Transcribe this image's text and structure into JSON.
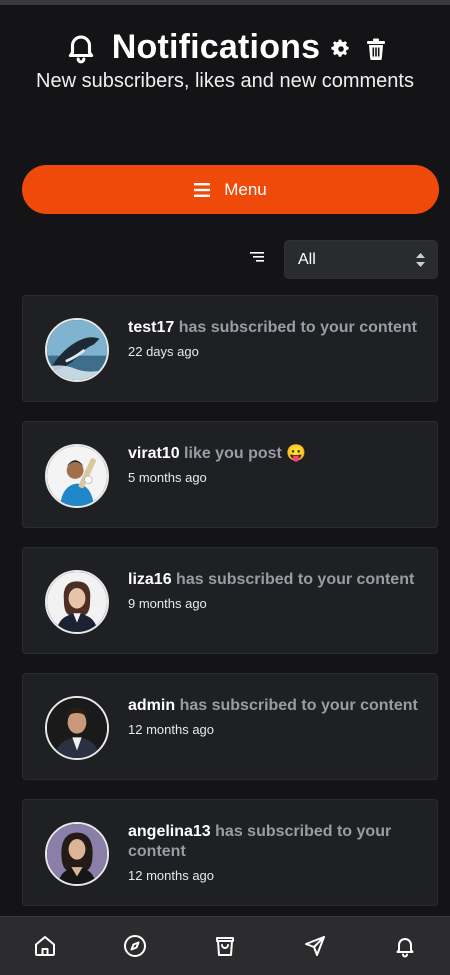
{
  "header": {
    "title": "Notifications",
    "subtitle": "New subscribers, likes and new comments",
    "icons": [
      "bell-icon",
      "gear-icon",
      "trash-icon"
    ]
  },
  "menu": {
    "label": "Menu",
    "color": "#f04a0a"
  },
  "filter": {
    "selected": "All"
  },
  "notifications": [
    {
      "user": "test17",
      "action": "has subscribed to your content",
      "time": "22 days ago"
    },
    {
      "user": "virat10",
      "action": "like you post 😛",
      "time": "5 months ago"
    },
    {
      "user": "liza16",
      "action": "has subscribed to your content",
      "time": "9 months ago"
    },
    {
      "user": "admin",
      "action": "has subscribed to your content",
      "time": "12 months ago"
    },
    {
      "user": "angelina13",
      "action": "has subscribed to your content",
      "time": "12 months ago"
    }
  ],
  "bottom_nav": {
    "icons": [
      "home-icon",
      "compass-icon",
      "shopping-bag-icon",
      "send-icon",
      "bell-icon"
    ]
  }
}
